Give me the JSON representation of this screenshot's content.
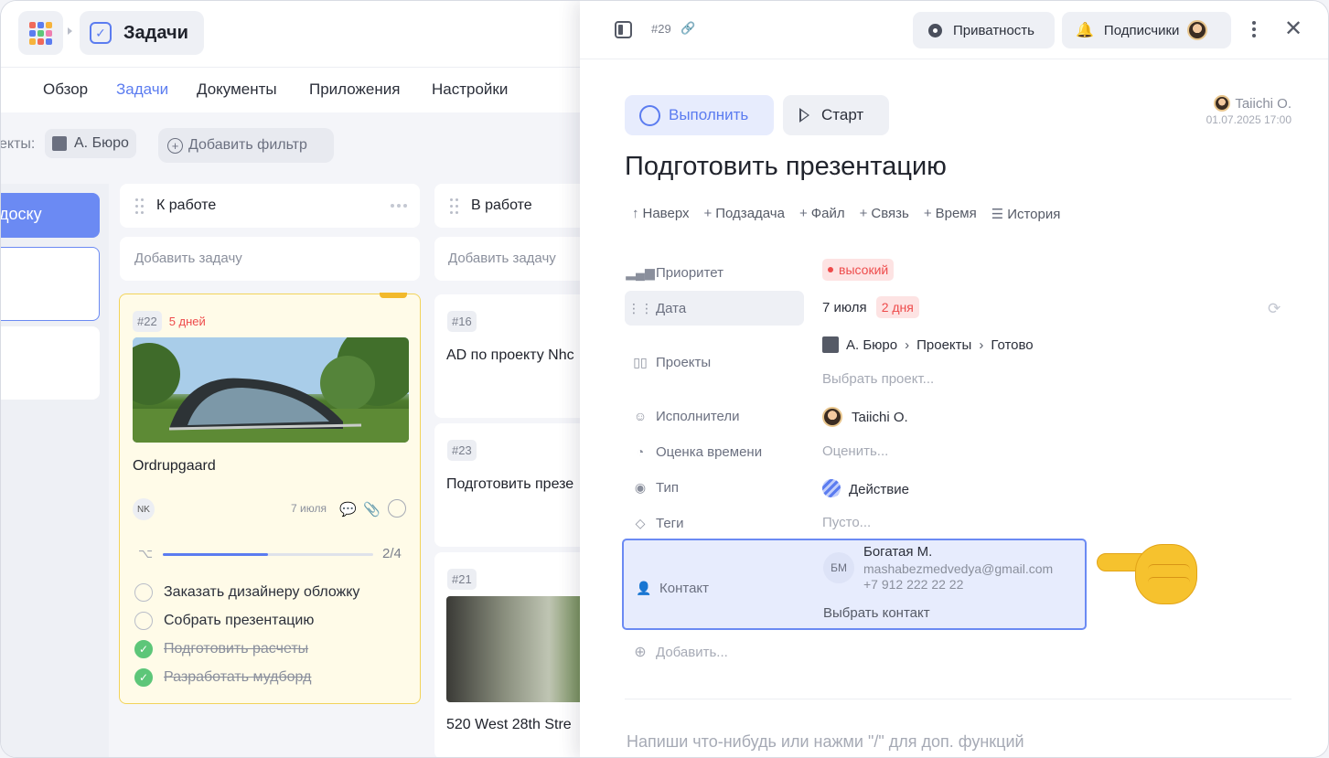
{
  "app": {
    "section_title": "Задачи",
    "nav_tabs": [
      {
        "label": "Обзор",
        "active": false
      },
      {
        "label": "Задачи",
        "active": true
      },
      {
        "label": "Документы",
        "active": false
      },
      {
        "label": "Приложения",
        "active": false
      },
      {
        "label": "Настройки",
        "active": false
      }
    ],
    "accent_color": "#5b7cf0"
  },
  "filters": {
    "label": "екты:",
    "project_chip": "А. Бюро",
    "add_filter": "Добавить фильтр"
  },
  "board": {
    "left_column_button": "доску",
    "columns": [
      {
        "name": "К работе",
        "add_task": "Добавить задачу"
      },
      {
        "name": "В работе",
        "add_task": "Добавить задачу"
      }
    ],
    "featured_card": {
      "id": "#22",
      "overdue": "5 дней",
      "title": "Ordrupgaard",
      "assignee_initials": "NK",
      "date": "7 июля",
      "subtasks_progress_label": "2/4",
      "subtasks_progress": 0.5,
      "checklist": [
        {
          "text": "Заказать дизайнеру обложку",
          "done": false
        },
        {
          "text": "Собрать презентацию",
          "done": false
        },
        {
          "text": "Подготовить расчеты",
          "done": true
        },
        {
          "text": "Разработать мудборд",
          "done": true
        }
      ]
    },
    "in_progress_cards": [
      {
        "id": "#16",
        "title": "AD по проекту Nhc"
      },
      {
        "id": "#23",
        "title": "Подготовить презе"
      },
      {
        "id": "#21",
        "title": "520 West 28th Stre"
      }
    ]
  },
  "task": {
    "id": "#29",
    "privacy_button": "Приватность",
    "subscribers_button": "Подписчики",
    "complete_button": "Выполнить",
    "start_button": "Старт",
    "author": "Taiichi O.",
    "created": "01.07.2025 17:00",
    "title": "Подготовить презентацию",
    "actions": [
      {
        "icon": "arrow-up",
        "label": "Наверх"
      },
      {
        "icon": "plus",
        "label": "Подзадача"
      },
      {
        "icon": "plus",
        "label": "Файл"
      },
      {
        "icon": "plus",
        "label": "Связь"
      },
      {
        "icon": "plus",
        "label": "Время"
      },
      {
        "icon": "list",
        "label": "История"
      }
    ],
    "properties": {
      "priority": {
        "label": "Приоритет",
        "value": "высокий"
      },
      "date": {
        "label": "Дата",
        "value": "7 июля",
        "badge": "2 дня"
      },
      "projects": {
        "label": "Проекты",
        "path": [
          "А. Бюро",
          "Проекты",
          "Готово"
        ],
        "placeholder": "Выбрать проект..."
      },
      "assignees": {
        "label": "Исполнители",
        "value": "Taiichi O."
      },
      "estimate": {
        "label": "Оценка времени",
        "placeholder": "Оценить..."
      },
      "type": {
        "label": "Тип",
        "value": "Действие"
      },
      "tags": {
        "label": "Теги",
        "placeholder": "Пусто..."
      },
      "contact": {
        "label": "Контакт",
        "initials": "БМ",
        "name": "Богатая М.",
        "email": "mashabezmedvedya@gmail.com",
        "phone": "+7 912 222 22 22",
        "choose": "Выбрать контакт"
      }
    },
    "add_property": "Добавить...",
    "editor_placeholder": "Напиши что-нибудь или нажми \"/\" для доп. функций"
  }
}
